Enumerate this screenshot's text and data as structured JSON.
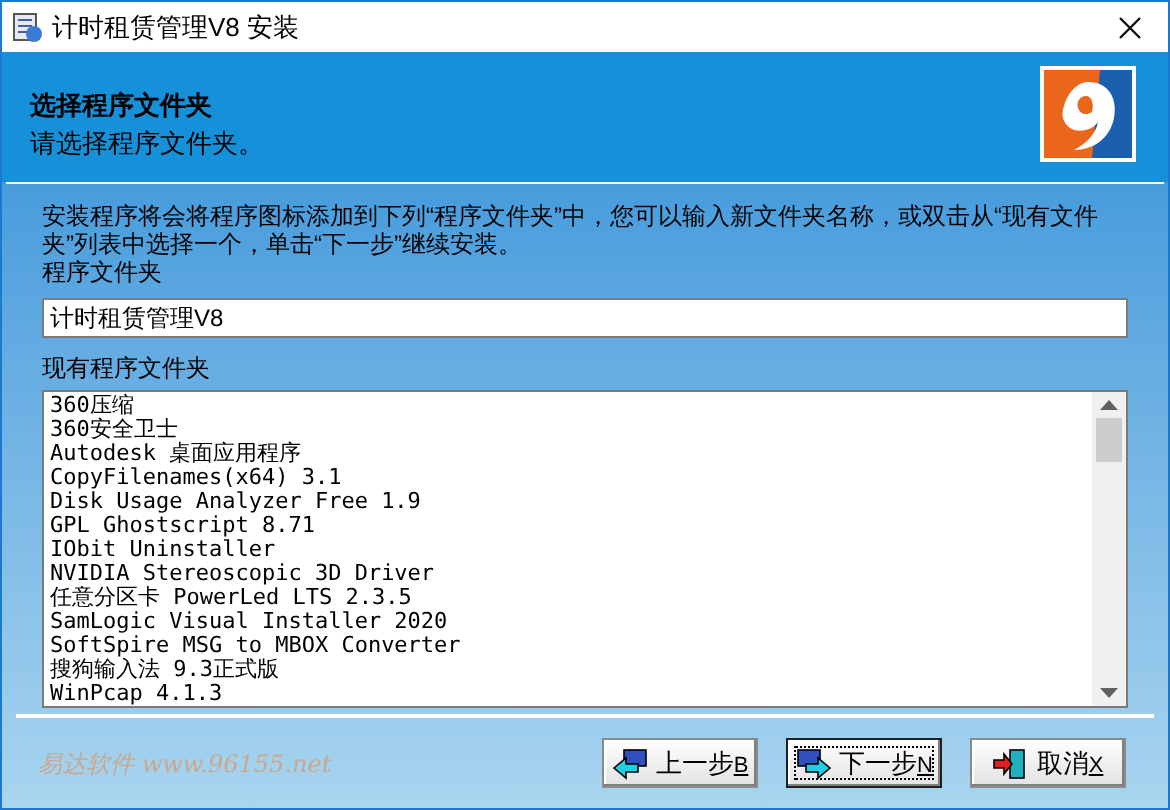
{
  "window": {
    "title": "计时租赁管理V8 安装"
  },
  "header": {
    "title": "选择程序文件夹",
    "subtitle": "请选择程序文件夹。"
  },
  "description": "安装程序将会将程序图标添加到下列“程序文件夹”中，您可以输入新文件夹名称，或双击从“现有文件夹”列表中选择一个，单击“下一步”继续安装。",
  "folder_field": {
    "label": "程序文件夹",
    "value": "计时租赁管理V8"
  },
  "existing_folders": {
    "label": "现有程序文件夹",
    "items": [
      "360压缩",
      "360安全卫士",
      "Autodesk 桌面应用程序",
      "CopyFilenames(x64) 3.1",
      "Disk Usage Analyzer Free 1.9",
      "GPL Ghostscript 8.71",
      "IObit Uninstaller",
      "NVIDIA Stereoscopic 3D Driver",
      "任意分区卡 PowerLed LTS 2.3.5",
      "SamLogic Visual Installer 2020",
      "SoftSpire MSG to MBOX Converter",
      "搜狗输入法 9.3正式版",
      "WinPcap 4.1.3"
    ]
  },
  "branding": "易达软件 www.96155.net",
  "buttons": [
    {
      "kind": "back",
      "label": "上一步",
      "accel": "B",
      "focused": false
    },
    {
      "kind": "next",
      "label": "下一步",
      "accel": "N",
      "focused": true
    },
    {
      "kind": "cancel",
      "label": "取消",
      "accel": "X",
      "focused": false
    }
  ]
}
